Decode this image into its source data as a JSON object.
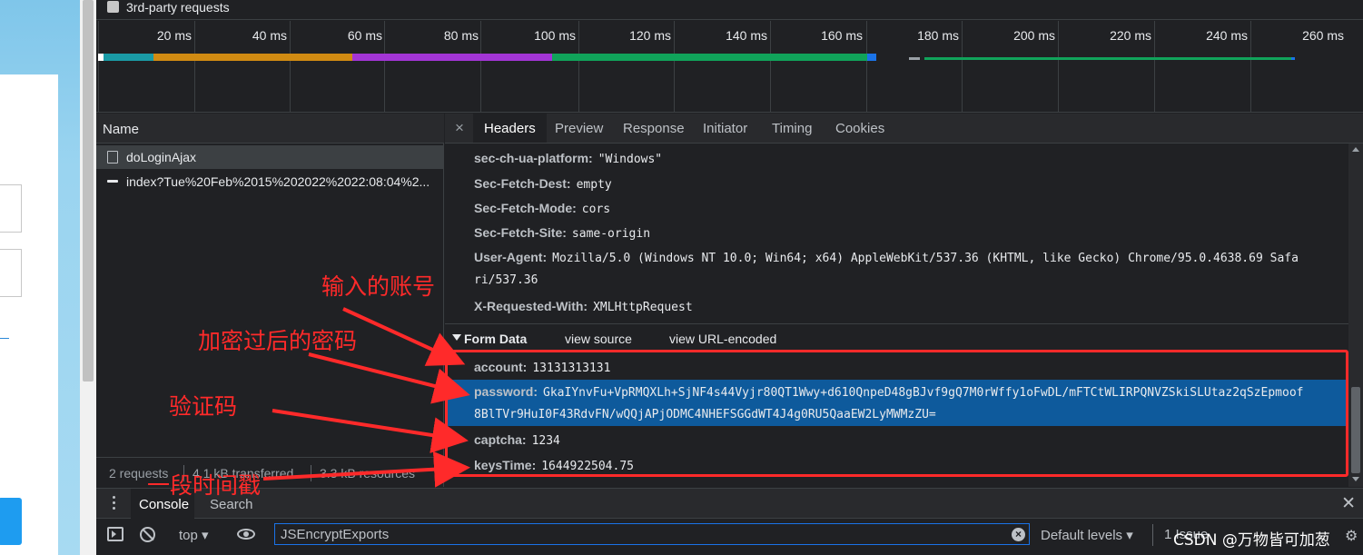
{
  "third_party": {
    "label": "3rd-party requests"
  },
  "timeline": {
    "ticks": [
      "20 ms",
      "40 ms",
      "60 ms",
      "80 ms",
      "100 ms",
      "120 ms",
      "140 ms",
      "160 ms",
      "180 ms",
      "200 ms",
      "220 ms",
      "240 ms",
      "260 ms"
    ],
    "colors": {
      "teal": "#1a9ba6",
      "orange": "#d18b12",
      "purple": "#a335d6",
      "green": "#10a35a",
      "blue": "#1a73e8"
    }
  },
  "requests": {
    "header": "Name",
    "items": [
      {
        "name": "doLoginAjax"
      },
      {
        "name": "index?Tue%20Feb%2015%202022%2022:08:04%2..."
      }
    ],
    "status": {
      "requests": "2 requests",
      "transferred": "4.1 kB transferred",
      "resources": "3.3 kB resources"
    }
  },
  "detail_tabs": [
    "Headers",
    "Preview",
    "Response",
    "Initiator",
    "Timing",
    "Cookies"
  ],
  "headers": [
    {
      "key": "sec-ch-ua-platform:",
      "value": "\"Windows\""
    },
    {
      "key": "Sec-Fetch-Dest:",
      "value": "empty"
    },
    {
      "key": "Sec-Fetch-Mode:",
      "value": "cors"
    },
    {
      "key": "Sec-Fetch-Site:",
      "value": "same-origin"
    },
    {
      "key": "User-Agent:",
      "value": "Mozilla/5.0 (Windows NT 10.0; Win64; x64) AppleWebKit/537.36 (KHTML, like Gecko) Chrome/95.0.4638.69 Safa",
      "value2": "ri/537.36"
    },
    {
      "key": "X-Requested-With:",
      "value": "XMLHttpRequest"
    }
  ],
  "form_data": {
    "title": "Form Data",
    "view_source": "view source",
    "view_url": "view URL-encoded",
    "fields": [
      {
        "key": "account:",
        "value": "13131313131"
      },
      {
        "key": "password:",
        "value": "GkaIYnvFu+VpRMQXLh+SjNF4s44Vyjr80QT1Wwy+d610QnpeD48gBJvf9gQ7M0rWffy1oFwDL/mFTCtWLIRPQNVZSkiSLUtaz2qSzEpmoof",
        "value2": "8BlTVr9HuI0F43RdvFN/wQQjAPjODMC4NHEFSGGdWT4J4g0RU5QaaEW2LyMWMzZU="
      },
      {
        "key": "captcha:",
        "value": "1234"
      },
      {
        "key": "keysTime:",
        "value": "1644922504.75"
      }
    ]
  },
  "drawer": {
    "console_tab": "Console",
    "search_tab": "Search"
  },
  "console_bar": {
    "context": "top",
    "filter_value": "JSEncryptExports",
    "levels": "Default levels",
    "issues": "1 Issue"
  },
  "annotations": {
    "account": "输入的账号",
    "password": "加密过后的密码",
    "captcha": "验证码",
    "keystime": "一段时间戳"
  },
  "watermark": "CSDN @万物皆可加葱",
  "colors": {
    "annotation_red": "#ff2a2a",
    "selected_blue": "#0e5a9c"
  }
}
